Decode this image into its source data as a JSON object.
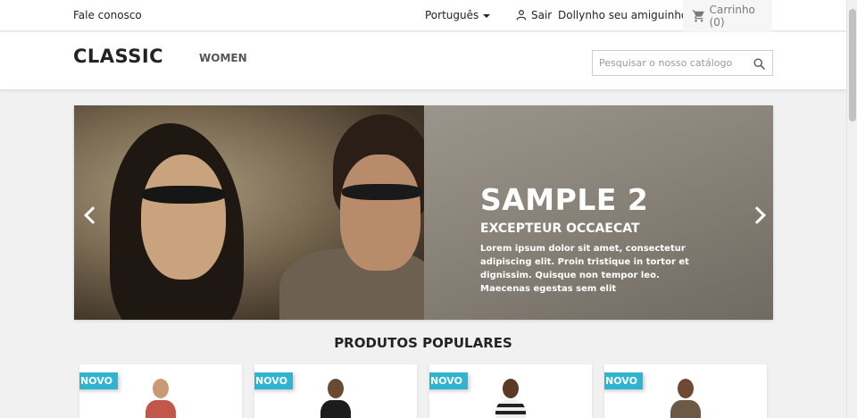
{
  "topnav": {
    "contact": "Fale conosco",
    "language": "Português",
    "signout": "Sair",
    "account": "Dollynho seu amiguinho",
    "cart": "Carrinho (0)"
  },
  "header": {
    "logo": "CLASSIC",
    "menu": [
      "WOMEN"
    ],
    "search_placeholder": "Pesquisar o nosso catálogo"
  },
  "slider": {
    "title": "SAMPLE 2",
    "subtitle": "EXCEPTEUR OCCAECAT",
    "text": "Lorem ipsum dolor sit amet, consectetur adipiscing elit. Proin tristique in tortor et dignissim. Quisque non tempor leo. Maecenas egestas sem elit"
  },
  "products": {
    "title": "PRODUTOS POPULARES",
    "items": [
      {
        "badge": "NOVO"
      },
      {
        "badge": "NOVO"
      },
      {
        "badge": "NOVO"
      },
      {
        "badge": "NOVO"
      }
    ]
  },
  "colors": {
    "accent": "#2fb5d2",
    "text": "#232323",
    "background": "#f1f1f1"
  },
  "icons": [
    "caret-down-icon",
    "user-icon",
    "cart-icon",
    "search-icon",
    "chevron-left-icon",
    "chevron-right-icon"
  ]
}
